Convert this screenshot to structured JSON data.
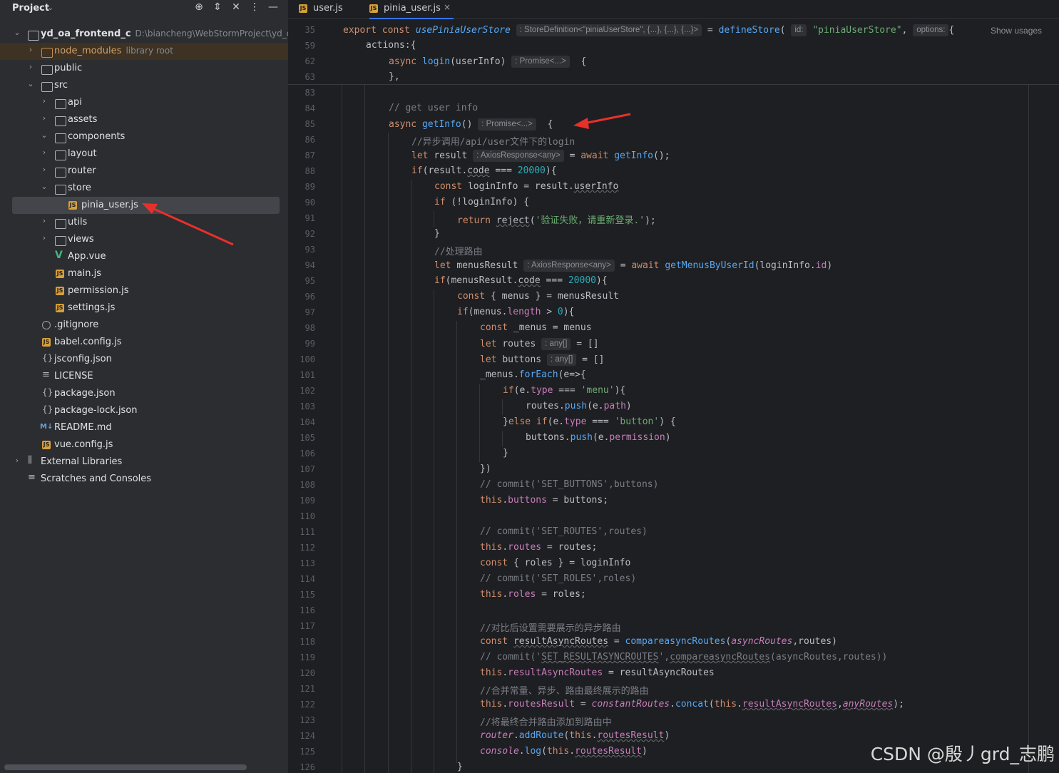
{
  "panel": {
    "title": "Project",
    "tree": [
      {
        "label": "yd_oa_frontend_c",
        "hint": "D:\\biancheng\\WebStormProject\\yd_oa_fr"
      },
      {
        "label": "node_modules",
        "hint": "library root"
      },
      {
        "label": "public"
      },
      {
        "label": "src"
      },
      {
        "label": "api"
      },
      {
        "label": "assets"
      },
      {
        "label": "components"
      },
      {
        "label": "layout"
      },
      {
        "label": "router"
      },
      {
        "label": "store"
      },
      {
        "label": "pinia_user.js"
      },
      {
        "label": "utils"
      },
      {
        "label": "views"
      },
      {
        "label": "App.vue"
      },
      {
        "label": "main.js"
      },
      {
        "label": "permission.js"
      },
      {
        "label": "settings.js"
      },
      {
        "label": ".gitignore"
      },
      {
        "label": "babel.config.js"
      },
      {
        "label": "jsconfig.json"
      },
      {
        "label": "LICENSE"
      },
      {
        "label": "package.json"
      },
      {
        "label": "package-lock.json"
      },
      {
        "label": "README.md"
      },
      {
        "label": "vue.config.js"
      },
      {
        "label": "External Libraries"
      },
      {
        "label": "Scratches and Consoles"
      }
    ]
  },
  "icons": {
    "js": "JS",
    "md": "M↓",
    "json": "{}",
    "vue": "V"
  },
  "tabs": [
    {
      "label": "user.js"
    },
    {
      "label": "pinia_user.js",
      "close": "×"
    }
  ],
  "sticky": {
    "lines": [
      {
        "n": "35",
        "kw": "export const ",
        "name": "usePiniaUserStore",
        "hint": ": StoreDefinition<\"piniaUserStore\", {...}, {...}, {...}>",
        "eq": " = ",
        "fn": "defineStore",
        "open": "(",
        "idhint": "id:",
        "str": "\"piniaUserStore\"",
        "comma": ",",
        "opthint": "options:",
        "brace": "{",
        "usages": "Show usages"
      },
      {
        "n": "59",
        "text": "actions:{"
      },
      {
        "n": "62",
        "kw": "async ",
        "fn": "login",
        "args": "(userInfo)",
        "hint": ": Promise<...>",
        "brace": "{"
      }
    ]
  },
  "code": {
    "l63": {
      "n": "63",
      "t": "},"
    },
    "l83": {
      "n": "83"
    },
    "l84": {
      "n": "84",
      "t": "// get user info"
    },
    "l85": {
      "n": "85",
      "a": "async ",
      "b": "getInfo",
      "c": "()",
      "hint": ": Promise<...>",
      "d": "{"
    },
    "l86": {
      "n": "86",
      "t": "//异步调用/api/user文件下的login"
    },
    "l87": {
      "n": "87",
      "a": "let ",
      "b": "result",
      "hint": ": AxiosResponse<any>",
      "c": " = ",
      "d": "await ",
      "e": "getInfo",
      "f": "();"
    },
    "l88": {
      "n": "88",
      "a": "if",
      "b": "(result.",
      "c": "code",
      "d": " === ",
      "e": "20000",
      "f": "){"
    },
    "l89": {
      "n": "89",
      "a": "const ",
      "b": "loginInfo = result.",
      "c": "userInfo"
    },
    "l90": {
      "n": "90",
      "a": "if ",
      "b": "(!loginInfo) {"
    },
    "l91": {
      "n": "91",
      "a": "return ",
      "b": "reject",
      "c": "(",
      "d": "'验证失败，请重新登录.'",
      "e": ");"
    },
    "l92": {
      "n": "92",
      "t": "}"
    },
    "l93": {
      "n": "93",
      "t": "//处理路由"
    },
    "l94": {
      "n": "94",
      "a": "let ",
      "b": "menusResult",
      "hint": ": AxiosResponse<any>",
      "c": " = ",
      "d": "await ",
      "e": "getMenusByUserId",
      "f": "(loginInfo.",
      "g": "id",
      "h": ")"
    },
    "l95": {
      "n": "95",
      "a": "if",
      "b": "(menusResult.",
      "c": "code",
      "d": " === ",
      "e": "20000",
      "f": "){"
    },
    "l96": {
      "n": "96",
      "a": "const ",
      "b": "{ menus } = menusResult"
    },
    "l97": {
      "n": "97",
      "a": "if",
      "b": "(menus.",
      "c": "length",
      "d": " > ",
      "e": "0",
      "f": "){"
    },
    "l98": {
      "n": "98",
      "a": "const ",
      "b": "_menus = menus"
    },
    "l99": {
      "n": "99",
      "a": "let ",
      "b": "routes",
      "hint": ": any[]",
      "c": " = []"
    },
    "l100": {
      "n": "100",
      "a": "let ",
      "b": "buttons",
      "hint": ": any[]",
      "c": " = []"
    },
    "l101": {
      "n": "101",
      "a": "_menus.",
      "b": "forEach",
      "c": "(e=>{"
    },
    "l102": {
      "n": "102",
      "a": "if",
      "b": "(e.",
      "c": "type",
      "d": " === ",
      "e": "'menu'",
      "f": "){"
    },
    "l103": {
      "n": "103",
      "a": "routes.",
      "b": "push",
      "c": "(e.",
      "d": "path",
      "e": ")"
    },
    "l104": {
      "n": "104",
      "a": "}",
      "b": "else if",
      "c": "(e.",
      "d": "type",
      "e": " === ",
      "f": "'button'",
      "g": ") {"
    },
    "l105": {
      "n": "105",
      "a": "buttons.",
      "b": "push",
      "c": "(e.",
      "d": "permission",
      "e": ")"
    },
    "l106": {
      "n": "106",
      "t": "}"
    },
    "l107": {
      "n": "107",
      "t": "})"
    },
    "l108": {
      "n": "108",
      "t": "// commit('SET_BUTTONS',buttons)"
    },
    "l109": {
      "n": "109",
      "a": "this",
      "b": ".",
      "c": "buttons",
      "d": " = buttons;"
    },
    "l110": {
      "n": "110"
    },
    "l111": {
      "n": "111",
      "t": "// commit('SET_ROUTES',routes)"
    },
    "l112": {
      "n": "112",
      "a": "this",
      "b": ".",
      "c": "routes",
      "d": " = routes;"
    },
    "l113": {
      "n": "113",
      "a": "const ",
      "b": "{ roles } = loginInfo"
    },
    "l114": {
      "n": "114",
      "t": "// commit('SET_ROLES',roles)"
    },
    "l115": {
      "n": "115",
      "a": "this",
      "b": ".",
      "c": "roles",
      "d": " = roles;"
    },
    "l116": {
      "n": "116"
    },
    "l117": {
      "n": "117",
      "t": "//对比后设置需要展示的异步路由"
    },
    "l118": {
      "n": "118",
      "a": "const ",
      "b": "resultAsyncRoutes",
      "c": " = ",
      "d": "compareasyncRoutes",
      "e": "(",
      "f": "asyncRoutes",
      "g": ",routes)"
    },
    "l119": {
      "n": "119",
      "a": "// commit('",
      "b": "SET_RESULTASYNCROUTES",
      "c": "',",
      "d": "compareasyncRoutes",
      "e": "(asyncRoutes,routes))"
    },
    "l120": {
      "n": "120",
      "a": "this",
      "b": ".",
      "c": "resultAsyncRoutes",
      "d": " = resultAsyncRoutes"
    },
    "l121": {
      "n": "121",
      "t": "//合并常量、异步、路由最终展示的路由"
    },
    "l122": {
      "n": "122",
      "a": "this",
      "b": ".",
      "c": "routesResult",
      "d": " = ",
      "e": "constantRoutes",
      "f": ".",
      "g": "concat",
      "h": "(",
      "i": "this",
      "j": ".",
      "k": "resultAsyncRoutes",
      "l": ",",
      "m": "anyRoutes",
      "o": ");"
    },
    "l123": {
      "n": "123",
      "t": "//将最终合并路由添加到路由中"
    },
    "l124": {
      "n": "124",
      "a": "router",
      "b": ".",
      "c": "addRoute",
      "d": "(",
      "e": "this",
      "f": ".",
      "g": "routesResult",
      "h": ")"
    },
    "l125": {
      "n": "125",
      "a": "console",
      "b": ".",
      "c": "log",
      "d": "(",
      "e": "this",
      "f": ".",
      "g": "routesResult",
      "h": ")"
    },
    "l126": {
      "n": "126",
      "t": "}"
    }
  },
  "watermark": "CSDN @殷丿grd_志鹏",
  "colors": {
    "accent": "#3574f0",
    "arrow": "#e8302a"
  }
}
